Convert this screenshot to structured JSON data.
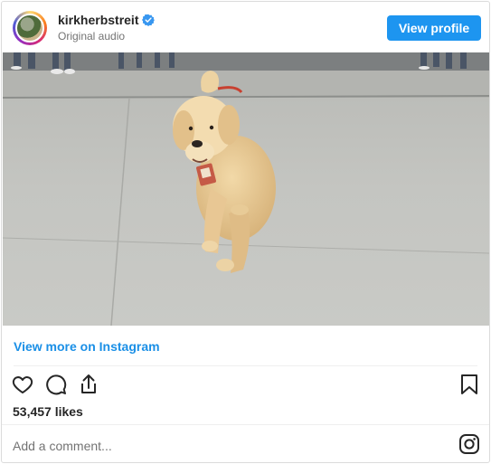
{
  "header": {
    "username": "kirkherbstreit",
    "subtitle": "Original audio",
    "view_profile_label": "View profile"
  },
  "media": {
    "icon": "video-frame"
  },
  "view_more_label": "View more on Instagram",
  "likes_label": "53,457 likes",
  "comment_placeholder": "Add a comment...",
  "icons": {
    "like": "heart-icon",
    "comment": "comment-icon",
    "share": "share-icon",
    "save": "bookmark-icon",
    "instagram": "instagram-icon",
    "verified": "verified-badge-icon"
  },
  "colors": {
    "accent": "#1d95f0",
    "link": "#1a8fe6"
  }
}
